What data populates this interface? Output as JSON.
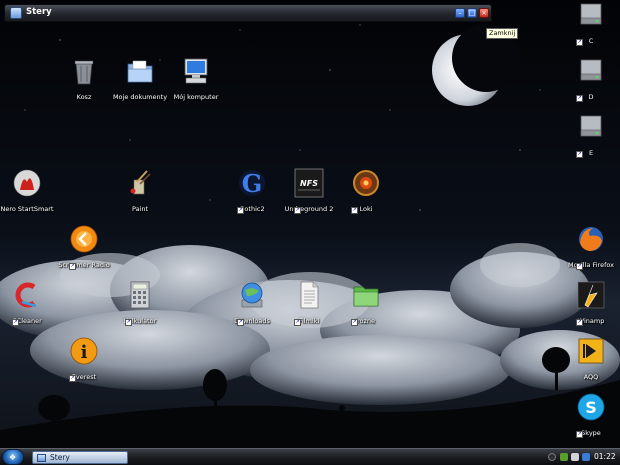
{
  "window": {
    "title": "Stery",
    "tooltip": "Zamknij"
  },
  "desktop": {
    "icons": [
      {
        "label": "Kosz"
      },
      {
        "label": "Moje dokumenty"
      },
      {
        "label": "Mój komputer"
      },
      {
        "label": "Nero StartSmart"
      },
      {
        "label": "Paint"
      },
      {
        "label": "Gothic2"
      },
      {
        "label": "Undreground 2"
      },
      {
        "label": "Loki"
      },
      {
        "label": "Screamer Radio"
      },
      {
        "label": "CCleaner"
      },
      {
        "label": "Kalkulator"
      },
      {
        "label": "Downloads"
      },
      {
        "label": "Filmiki"
      },
      {
        "label": "rozne"
      },
      {
        "label": "Everest"
      },
      {
        "label": "C"
      },
      {
        "label": "D"
      },
      {
        "label": "E"
      },
      {
        "label": "Mozilla Firefox"
      },
      {
        "label": "Winamp"
      },
      {
        "label": "AQQ"
      },
      {
        "label": "Skype"
      }
    ],
    "icon_art": {
      "gothic": "G",
      "nfs": "NFS",
      "everest": "i"
    }
  },
  "taskbar": {
    "task_label": "Stery",
    "clock": "01:22"
  },
  "colors": {
    "sky": "#05070c",
    "taskbar": "#17191d",
    "accent": "#2e64c9"
  }
}
